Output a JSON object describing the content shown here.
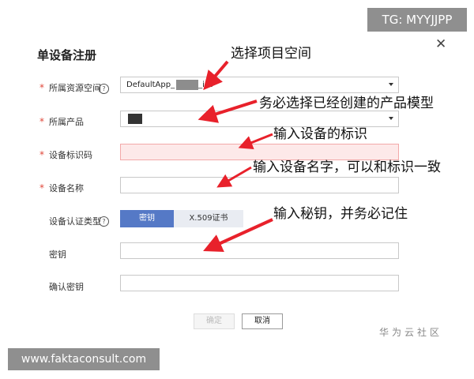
{
  "badges": {
    "telegram": "TG: MYYJJPP",
    "site": "www.faktaconsult.com"
  },
  "dialog": {
    "title": "单设备注册",
    "fields": {
      "space": {
        "label": "所属资源空间",
        "value": "DefaultApp_",
        "value_tail": "_iot",
        "required": true,
        "has_help": true
      },
      "product": {
        "label": "所属产品",
        "value": "",
        "required": true
      },
      "identifier": {
        "label": "设备标识码",
        "value": "",
        "required": true,
        "state": "error"
      },
      "device_name": {
        "label": "设备名称",
        "value": "",
        "required": true
      },
      "auth_type": {
        "label": "设备认证类型",
        "options": [
          "密钥",
          "X.509证书"
        ],
        "selected": "密钥",
        "has_help": true
      },
      "secret": {
        "label": "密钥",
        "value": ""
      },
      "confirm_secret": {
        "label": "确认密钥",
        "value": ""
      }
    },
    "buttons": {
      "confirm": "确定",
      "cancel": "取消"
    }
  },
  "annotations": {
    "select_space": "选择项目空间",
    "select_product": "务必选择已经创建的产品模型",
    "enter_identifier": "输入设备的标识",
    "enter_name": "输入设备名字，可以和标识一致",
    "enter_secret": "输入秘钥，并务必记住"
  },
  "watermark": "华为云社区",
  "colors": {
    "accent": "#5579c6",
    "required": "#e0473a",
    "error_bg": "#fde9e9",
    "arrow": "#e8212b"
  }
}
